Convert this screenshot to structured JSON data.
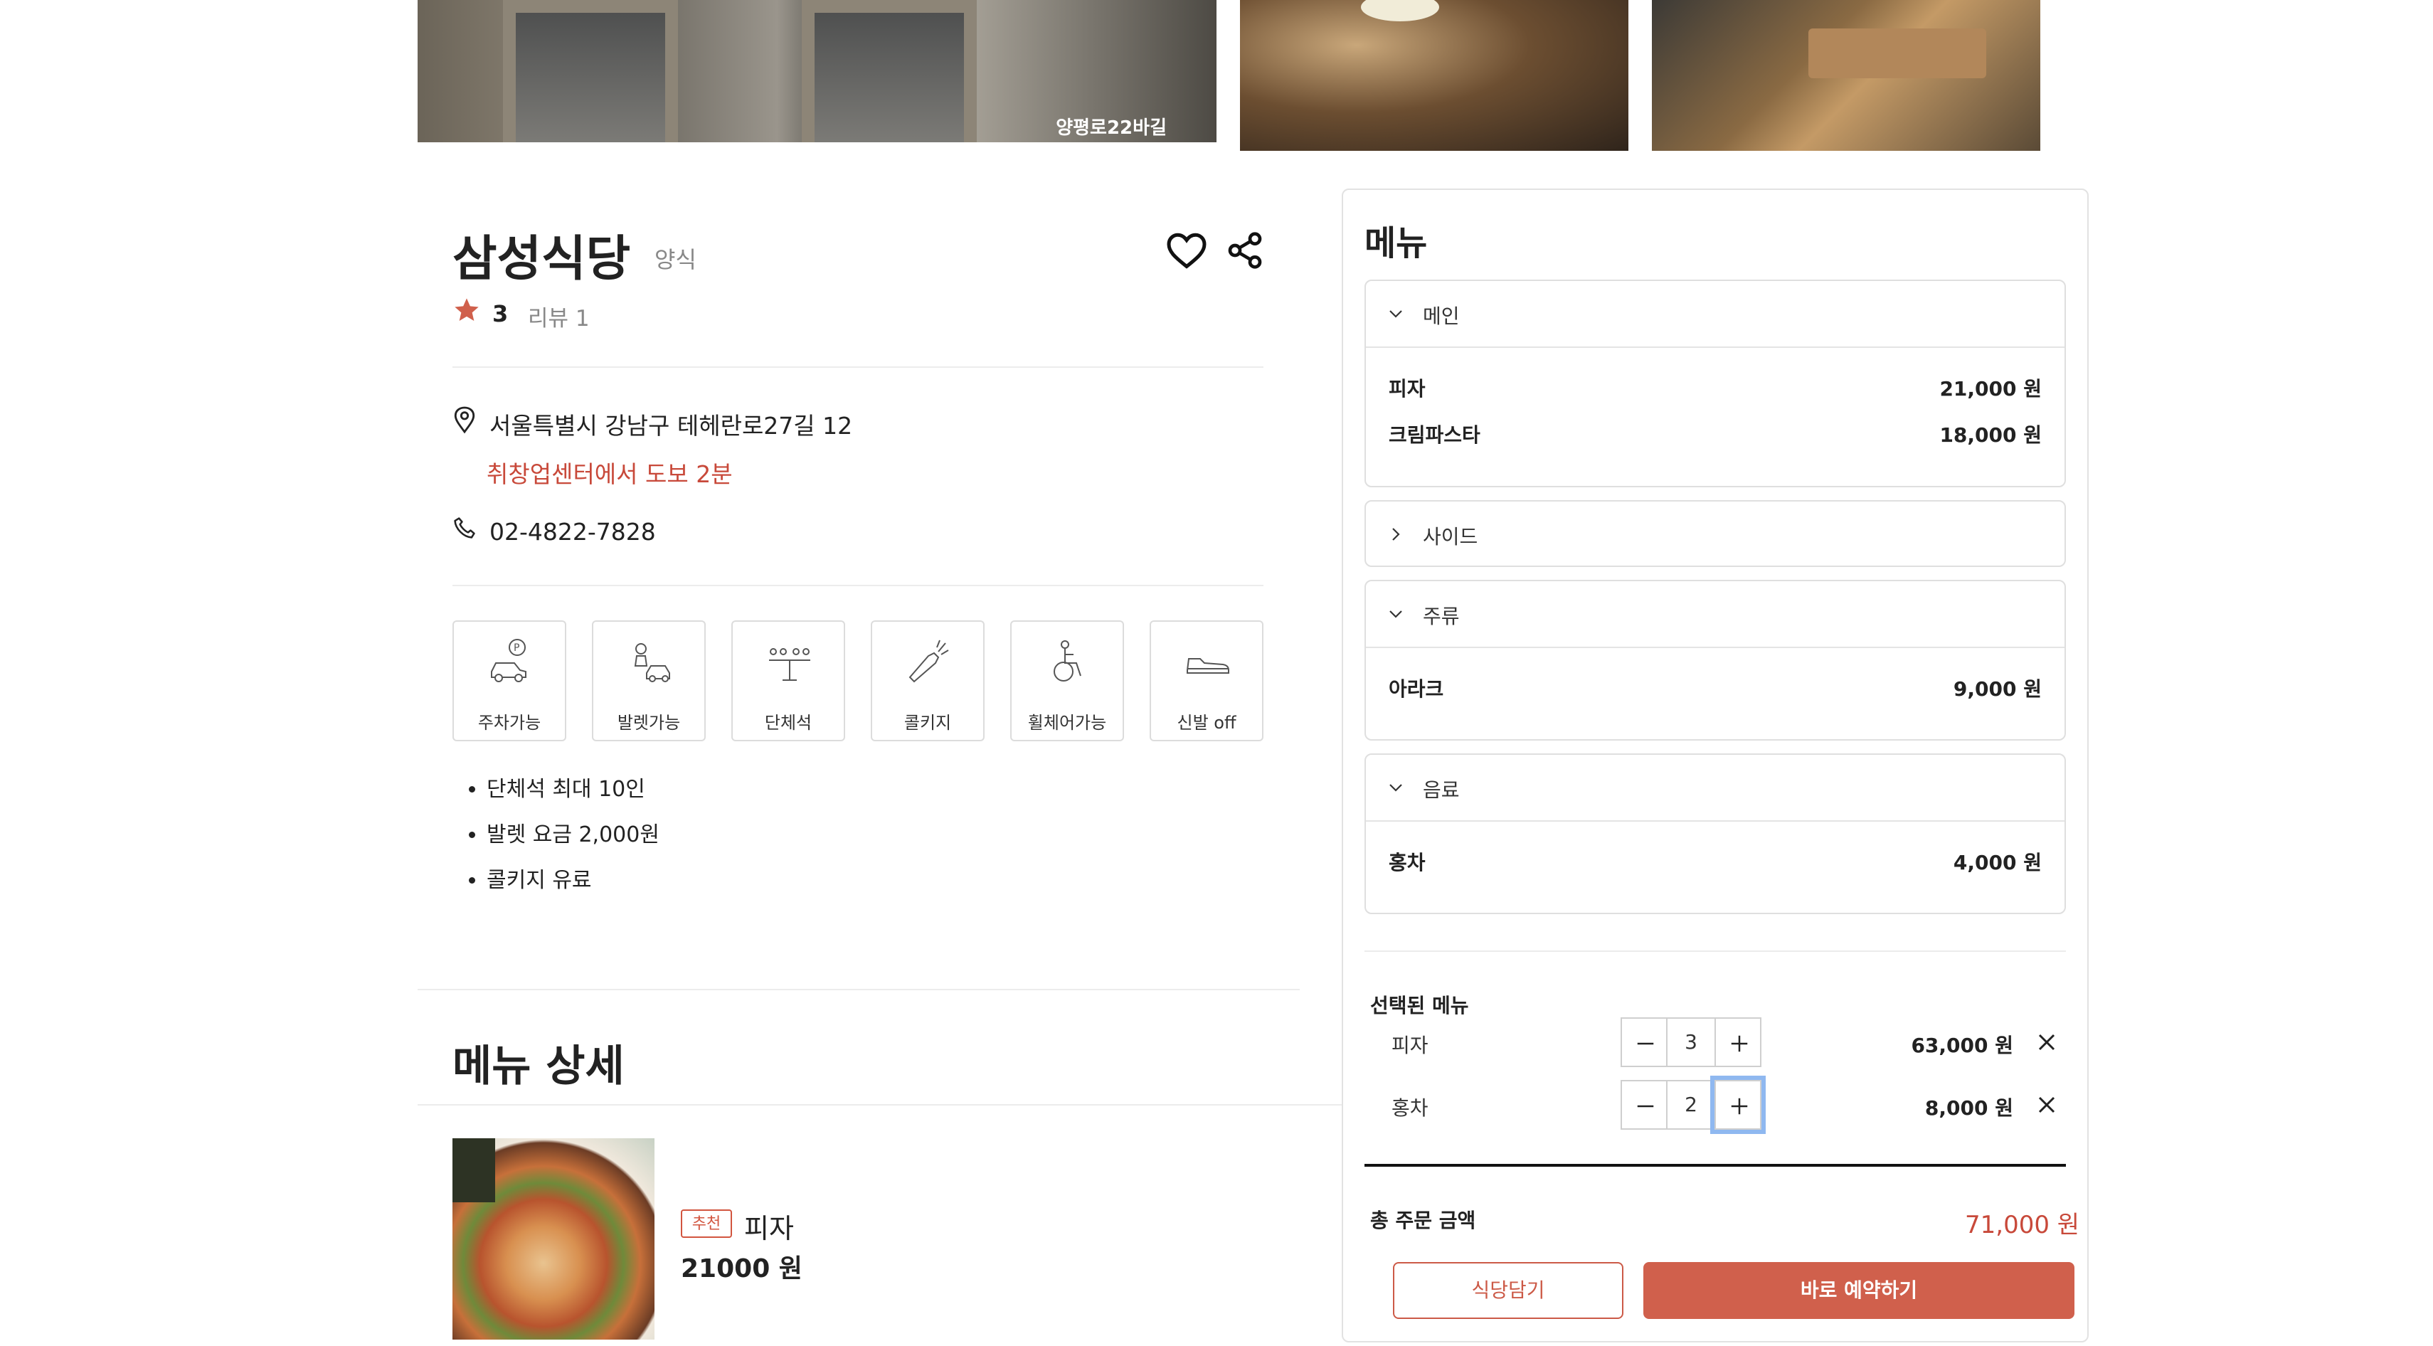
{
  "gallery": {
    "street_sign": "양평로22바길"
  },
  "restaurant": {
    "name": "삼성식당",
    "category": "양식",
    "rating": "3",
    "reviews": "리뷰 1",
    "address": "서울특별시 강남구 테헤란로27길 12",
    "walk_info": "취창업센터에서 도보 2분",
    "phone": "02-4822-7828"
  },
  "amenities": [
    {
      "label": "주차가능",
      "icon": "parking-car-icon"
    },
    {
      "label": "발렛가능",
      "icon": "valet-icon"
    },
    {
      "label": "단체석",
      "icon": "group-seating-icon"
    },
    {
      "label": "콜키지",
      "icon": "corkage-bottle-icon"
    },
    {
      "label": "휠체어가능",
      "icon": "wheelchair-icon"
    },
    {
      "label": "신발 off",
      "icon": "shoe-icon"
    }
  ],
  "notes": [
    "단체석 최대 10인",
    "발렛 요금 2,000원",
    "콜키지 유료"
  ],
  "menu_detail": {
    "title": "메뉴 상세",
    "item": {
      "badge": "추천",
      "name": "피자",
      "price": "21000 원"
    }
  },
  "menu_panel": {
    "title": "메뉴",
    "categories": [
      {
        "name": "메인",
        "expanded": true,
        "items": [
          {
            "name": "피자",
            "price": "21,000 원"
          },
          {
            "name": "크림파스타",
            "price": "18,000 원"
          }
        ]
      },
      {
        "name": "사이드",
        "expanded": false,
        "items": []
      },
      {
        "name": "주류",
        "expanded": true,
        "items": [
          {
            "name": "아라크",
            "price": "9,000 원"
          }
        ]
      },
      {
        "name": "음료",
        "expanded": true,
        "items": [
          {
            "name": "홍차",
            "price": "4,000 원"
          }
        ]
      }
    ],
    "selected_title": "선택된 메뉴",
    "selected": [
      {
        "name": "피자",
        "qty": "3",
        "price": "63,000 원"
      },
      {
        "name": "홍차",
        "qty": "2",
        "price": "8,000 원"
      }
    ],
    "total_label": "총 주문 금액",
    "total_value": "71,000 원",
    "cart_button": "식당담기",
    "book_button": "바로 예약하기"
  },
  "colors": {
    "accent": "#d0604c",
    "accent_text": "#c8493a",
    "focus": "#8fb8f0"
  }
}
